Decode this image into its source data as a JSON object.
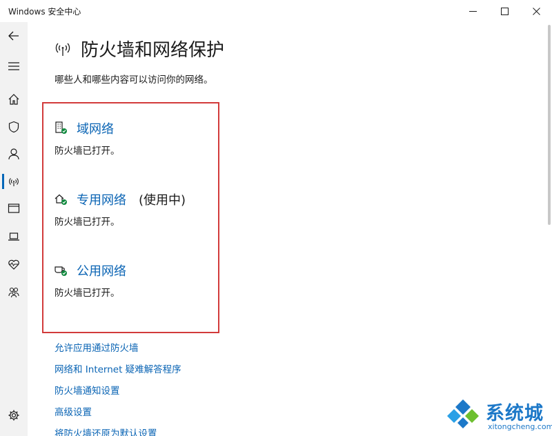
{
  "window": {
    "title": "Windows 安全中心"
  },
  "sidebar": {
    "items": [
      {
        "icon": "back-arrow-icon"
      },
      {
        "icon": "hamburger-menu-icon"
      },
      {
        "icon": "home-icon"
      },
      {
        "icon": "shield-icon"
      },
      {
        "icon": "person-icon"
      },
      {
        "icon": "wifi-signal-icon",
        "active": true
      },
      {
        "icon": "browser-window-icon"
      },
      {
        "icon": "laptop-icon"
      },
      {
        "icon": "heart-pulse-icon"
      },
      {
        "icon": "family-icon"
      },
      {
        "icon": "gear-icon"
      }
    ],
    "accent": "#0067b8"
  },
  "page": {
    "title": "防火墙和网络保护",
    "subtitle": "哪些人和哪些内容可以访问你的网络。"
  },
  "networks": [
    {
      "name": "域网络",
      "in_use": "",
      "status": "防火墙已打开。",
      "icon": "domain-network-icon"
    },
    {
      "name": "专用网络",
      "in_use": "(使用中)",
      "status": "防火墙已打开。",
      "icon": "private-network-icon"
    },
    {
      "name": "公用网络",
      "in_use": "",
      "status": "防火墙已打开。",
      "icon": "public-network-icon"
    }
  ],
  "links": [
    "允许应用通过防火墙",
    "网络和 Internet 疑难解答程序",
    "防火墙通知设置",
    "高级设置",
    "将防火墙还原为默认设置"
  ],
  "watermark": {
    "text": "系统城",
    "url": "xitongcheng.com"
  },
  "colors": {
    "link": "#0a64b4",
    "highlight": "#d23a3a",
    "ok": "#10893e"
  }
}
